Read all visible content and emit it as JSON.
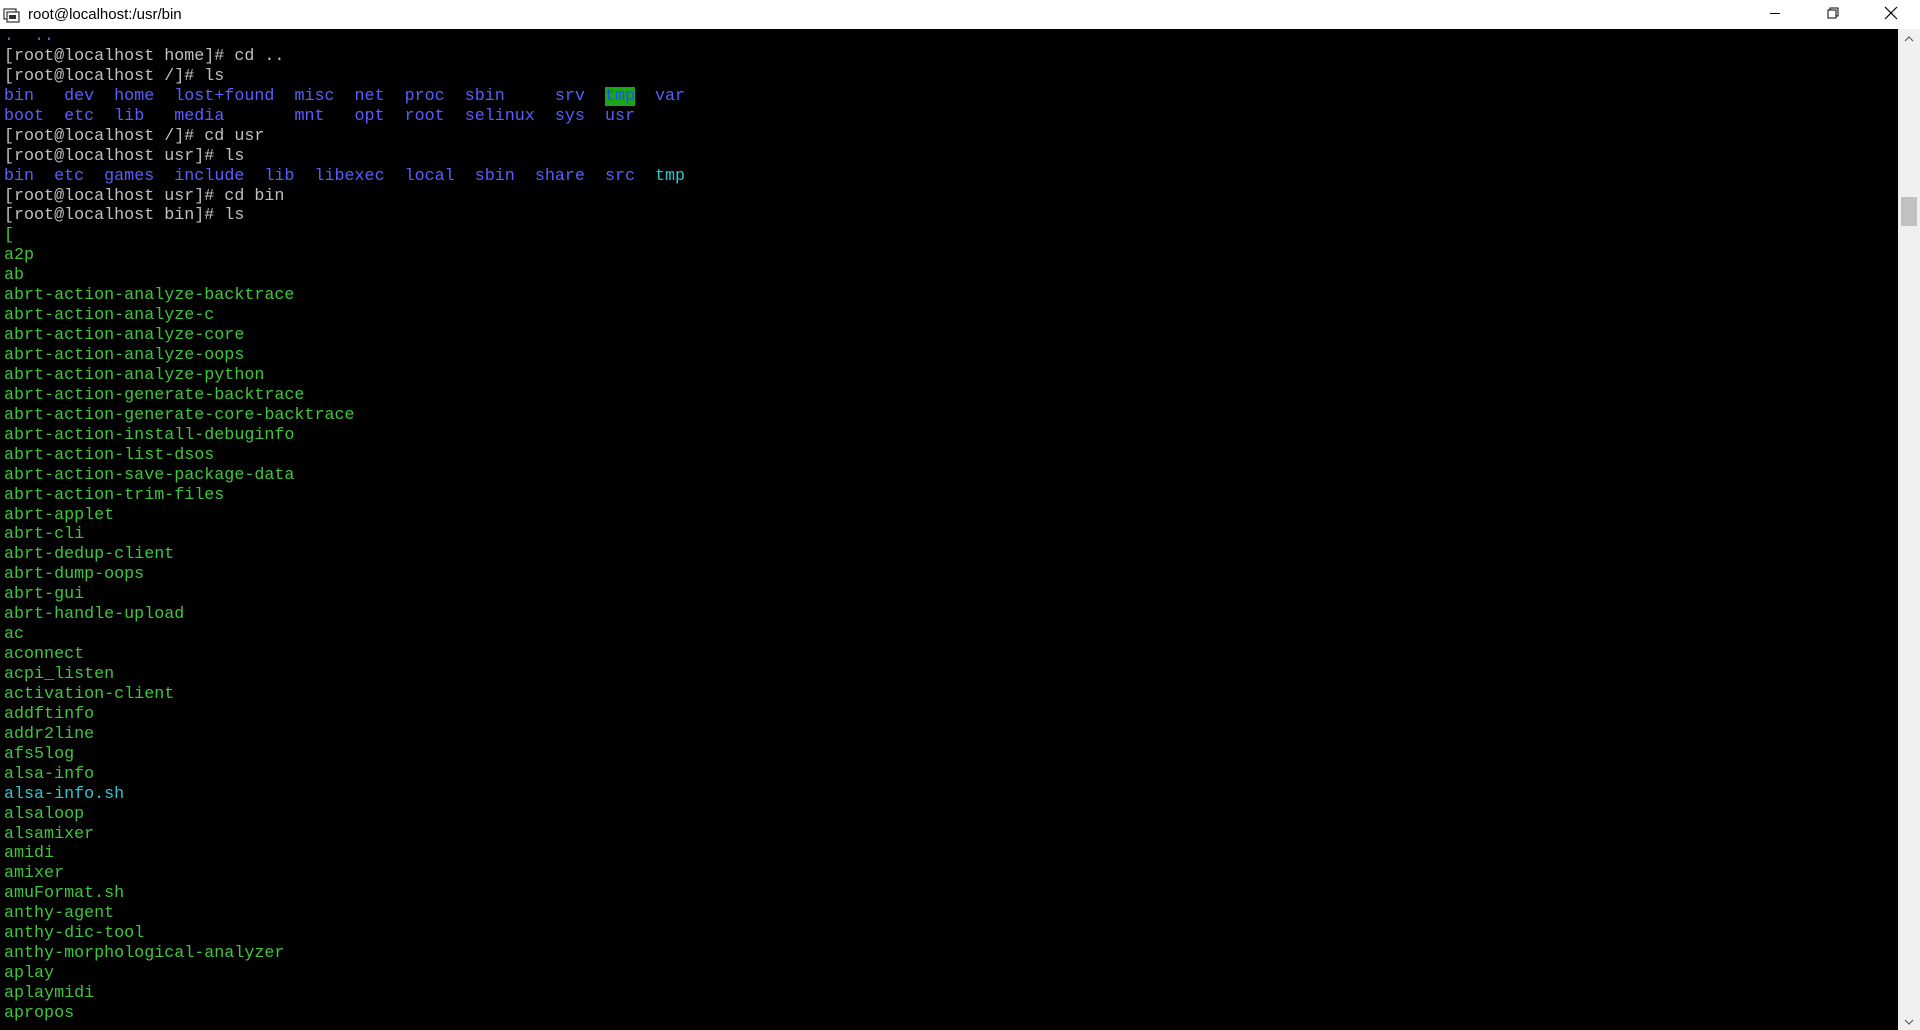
{
  "window": {
    "title": "root@localhost:/usr/bin",
    "icons": {
      "app": "terminal-app-icon",
      "minimize": "minimize-icon",
      "maximize": "restore-icon",
      "close": "close-icon"
    }
  },
  "colors": {
    "background": "#000000",
    "default_text": "#c0c0c0",
    "directory": "#5c5cff",
    "executable": "#3ec63e",
    "script_link": "#2ec7d3",
    "sticky_highlight_bg": "#19a619"
  },
  "terminal": {
    "lines": [
      [
        {
          "t": ".  ..",
          "c": "blue"
        }
      ],
      [
        {
          "t": "[root@localhost home]# cd ..",
          "c": "white"
        }
      ],
      [
        {
          "t": "[root@localhost /]# ls",
          "c": "white"
        }
      ],
      [
        {
          "t": "bin",
          "c": "blue"
        },
        {
          "t": "   ",
          "c": "white"
        },
        {
          "t": "dev",
          "c": "blue"
        },
        {
          "t": "  ",
          "c": "white"
        },
        {
          "t": "home",
          "c": "blue"
        },
        {
          "t": "  ",
          "c": "white"
        },
        {
          "t": "lost+found",
          "c": "blue"
        },
        {
          "t": "  ",
          "c": "white"
        },
        {
          "t": "misc",
          "c": "blue"
        },
        {
          "t": "  ",
          "c": "white"
        },
        {
          "t": "net",
          "c": "blue"
        },
        {
          "t": "  ",
          "c": "white"
        },
        {
          "t": "proc",
          "c": "blue"
        },
        {
          "t": "  ",
          "c": "white"
        },
        {
          "t": "sbin",
          "c": "blue"
        },
        {
          "t": "     ",
          "c": "white"
        },
        {
          "t": "srv",
          "c": "blue"
        },
        {
          "t": "  ",
          "c": "white"
        },
        {
          "t": "tmp",
          "c": "tmp-hl"
        },
        {
          "t": "  ",
          "c": "white"
        },
        {
          "t": "var",
          "c": "blue"
        }
      ],
      [
        {
          "t": "boot",
          "c": "blue"
        },
        {
          "t": "  ",
          "c": "white"
        },
        {
          "t": "etc",
          "c": "blue"
        },
        {
          "t": "  ",
          "c": "white"
        },
        {
          "t": "lib",
          "c": "blue"
        },
        {
          "t": "   ",
          "c": "white"
        },
        {
          "t": "media",
          "c": "blue"
        },
        {
          "t": "       ",
          "c": "white"
        },
        {
          "t": "mnt",
          "c": "blue"
        },
        {
          "t": "   ",
          "c": "white"
        },
        {
          "t": "opt",
          "c": "blue"
        },
        {
          "t": "  ",
          "c": "white"
        },
        {
          "t": "root",
          "c": "blue"
        },
        {
          "t": "  ",
          "c": "white"
        },
        {
          "t": "selinux",
          "c": "blue"
        },
        {
          "t": "  ",
          "c": "white"
        },
        {
          "t": "sys",
          "c": "blue"
        },
        {
          "t": "  ",
          "c": "white"
        },
        {
          "t": "usr",
          "c": "blue"
        }
      ],
      [
        {
          "t": "[root@localhost /]# cd usr",
          "c": "white"
        }
      ],
      [
        {
          "t": "[root@localhost usr]# ls",
          "c": "white"
        }
      ],
      [
        {
          "t": "bin",
          "c": "blue"
        },
        {
          "t": "  ",
          "c": "white"
        },
        {
          "t": "etc",
          "c": "blue"
        },
        {
          "t": "  ",
          "c": "white"
        },
        {
          "t": "games",
          "c": "blue"
        },
        {
          "t": "  ",
          "c": "white"
        },
        {
          "t": "include",
          "c": "blue"
        },
        {
          "t": "  ",
          "c": "white"
        },
        {
          "t": "lib",
          "c": "blue"
        },
        {
          "t": "  ",
          "c": "white"
        },
        {
          "t": "libexec",
          "c": "blue"
        },
        {
          "t": "  ",
          "c": "white"
        },
        {
          "t": "local",
          "c": "blue"
        },
        {
          "t": "  ",
          "c": "white"
        },
        {
          "t": "sbin",
          "c": "blue"
        },
        {
          "t": "  ",
          "c": "white"
        },
        {
          "t": "share",
          "c": "blue"
        },
        {
          "t": "  ",
          "c": "white"
        },
        {
          "t": "src",
          "c": "blue"
        },
        {
          "t": "  ",
          "c": "white"
        },
        {
          "t": "tmp",
          "c": "cyan"
        }
      ],
      [
        {
          "t": "[root@localhost usr]# cd bin",
          "c": "white"
        }
      ],
      [
        {
          "t": "[root@localhost bin]# ls",
          "c": "white"
        }
      ],
      [
        {
          "t": "[",
          "c": "green"
        }
      ],
      [
        {
          "t": "a2p",
          "c": "green"
        }
      ],
      [
        {
          "t": "ab",
          "c": "green"
        }
      ],
      [
        {
          "t": "abrt-action-analyze-backtrace",
          "c": "green"
        }
      ],
      [
        {
          "t": "abrt-action-analyze-c",
          "c": "green"
        }
      ],
      [
        {
          "t": "abrt-action-analyze-core",
          "c": "green"
        }
      ],
      [
        {
          "t": "abrt-action-analyze-oops",
          "c": "green"
        }
      ],
      [
        {
          "t": "abrt-action-analyze-python",
          "c": "green"
        }
      ],
      [
        {
          "t": "abrt-action-generate-backtrace",
          "c": "green"
        }
      ],
      [
        {
          "t": "abrt-action-generate-core-backtrace",
          "c": "green"
        }
      ],
      [
        {
          "t": "abrt-action-install-debuginfo",
          "c": "green"
        }
      ],
      [
        {
          "t": "abrt-action-list-dsos",
          "c": "green"
        }
      ],
      [
        {
          "t": "abrt-action-save-package-data",
          "c": "green"
        }
      ],
      [
        {
          "t": "abrt-action-trim-files",
          "c": "green"
        }
      ],
      [
        {
          "t": "abrt-applet",
          "c": "green"
        }
      ],
      [
        {
          "t": "abrt-cli",
          "c": "green"
        }
      ],
      [
        {
          "t": "abrt-dedup-client",
          "c": "green"
        }
      ],
      [
        {
          "t": "abrt-dump-oops",
          "c": "green"
        }
      ],
      [
        {
          "t": "abrt-gui",
          "c": "green"
        }
      ],
      [
        {
          "t": "abrt-handle-upload",
          "c": "green"
        }
      ],
      [
        {
          "t": "ac",
          "c": "green"
        }
      ],
      [
        {
          "t": "aconnect",
          "c": "green"
        }
      ],
      [
        {
          "t": "acpi_listen",
          "c": "green"
        }
      ],
      [
        {
          "t": "activation-client",
          "c": "green"
        }
      ],
      [
        {
          "t": "addftinfo",
          "c": "green"
        }
      ],
      [
        {
          "t": "addr2line",
          "c": "green"
        }
      ],
      [
        {
          "t": "afs5log",
          "c": "green"
        }
      ],
      [
        {
          "t": "alsa-info",
          "c": "green"
        }
      ],
      [
        {
          "t": "alsa-info.sh",
          "c": "cyan"
        }
      ],
      [
        {
          "t": "alsaloop",
          "c": "green"
        }
      ],
      [
        {
          "t": "alsamixer",
          "c": "green"
        }
      ],
      [
        {
          "t": "amidi",
          "c": "green"
        }
      ],
      [
        {
          "t": "amixer",
          "c": "green"
        }
      ],
      [
        {
          "t": "amuFormat.sh",
          "c": "green"
        }
      ],
      [
        {
          "t": "anthy-agent",
          "c": "green"
        }
      ],
      [
        {
          "t": "anthy-dic-tool",
          "c": "green"
        }
      ],
      [
        {
          "t": "anthy-morphological-analyzer",
          "c": "green"
        }
      ],
      [
        {
          "t": "aplay",
          "c": "green"
        }
      ],
      [
        {
          "t": "aplaymidi",
          "c": "green"
        }
      ],
      [
        {
          "t": "apropos",
          "c": "green"
        }
      ]
    ]
  },
  "scrollbar": {
    "icons": {
      "up": "scroll-up-arrow-icon",
      "down": "scroll-down-arrow-icon"
    },
    "position_fraction": 0.17
  }
}
